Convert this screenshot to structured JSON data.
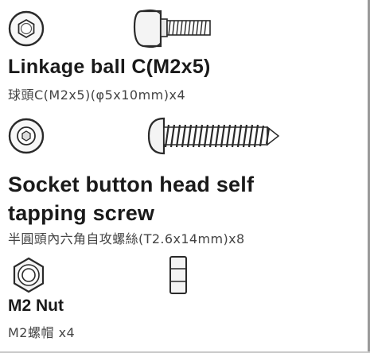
{
  "items": [
    {
      "title": "Linkage ball C(M2x5)",
      "subtitle": "球頭C(M2x5)(φ5x10mm)x4",
      "icons": [
        "linkage-ball-end-view-icon",
        "linkage-ball-side-view-icon"
      ]
    },
    {
      "title_line1": "Socket button head self",
      "title_line2": "tapping screw",
      "subtitle": "半圓頭內六角自攻螺絲(T2.6x14mm)x8",
      "icons": [
        "screw-head-top-view-icon",
        "self-tapping-screw-side-view-icon"
      ]
    },
    {
      "title": "M2 Nut",
      "subtitle": "M2螺帽 x4",
      "icons": [
        "hex-nut-top-view-icon",
        "hex-nut-side-view-icon"
      ]
    }
  ],
  "colors": {
    "ink": "#1a1a1a",
    "subtext": "#444444",
    "part_outline": "#2a2a2a",
    "part_fill": "#f4f4f4"
  }
}
